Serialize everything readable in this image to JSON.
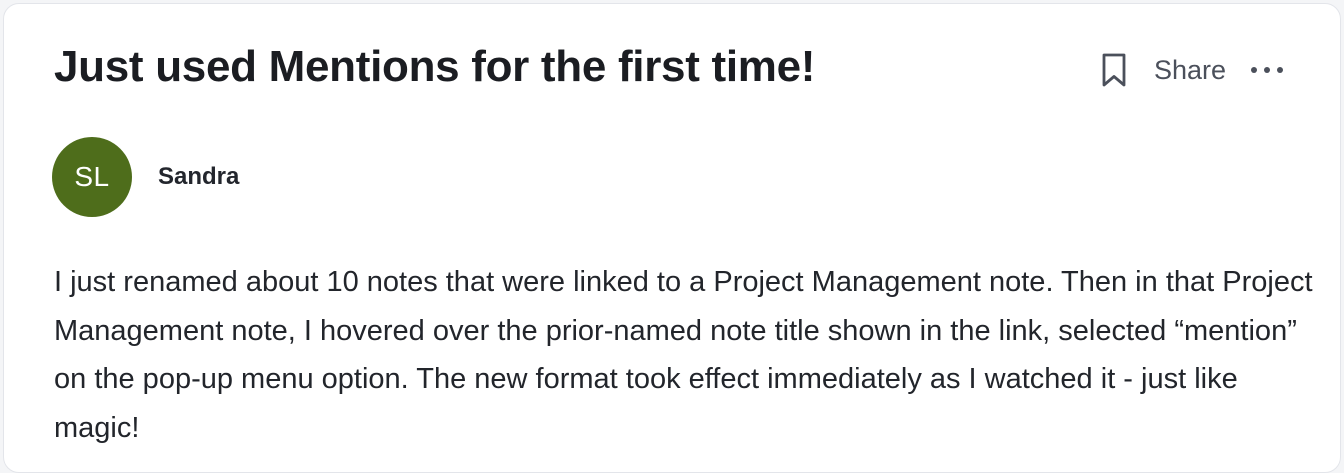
{
  "post": {
    "title": "Just used Mentions for the first time!",
    "share_label": "Share",
    "author": {
      "initials": "SL",
      "name": "Sandra",
      "avatar_color": "#4e6d1b"
    },
    "body": "I just renamed about 10 notes that were linked to a Project Management note. Then in that Project Management note, I hovered over the prior-named note title shown in the link, selected “mention” on the pop-up menu option. The new format took effect immediately as I watched it - just like magic!"
  },
  "icons": {
    "bookmark": "bookmark-icon",
    "more": "more-horizontal-icon"
  }
}
